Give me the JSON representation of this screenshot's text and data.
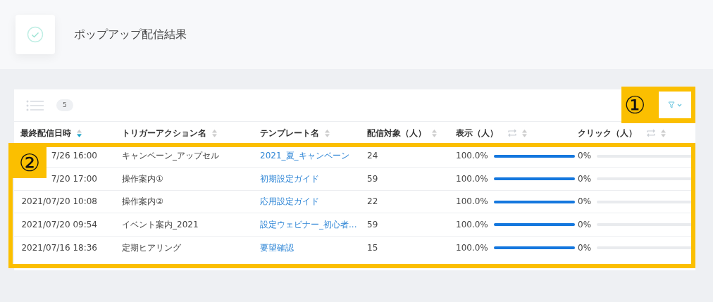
{
  "page": {
    "title": "ポップアップ配信結果"
  },
  "toolbar": {
    "count": "5"
  },
  "table": {
    "columns": [
      {
        "label": "最終配信日時",
        "sorted": true,
        "toggle": false
      },
      {
        "label": "トリガーアクション名",
        "sorted": false,
        "toggle": false
      },
      {
        "label": "テンプレート名",
        "sorted": false,
        "toggle": false
      },
      {
        "label": "配信対象（人）",
        "sorted": false,
        "toggle": false
      },
      {
        "label": "表示（人）",
        "sorted": false,
        "toggle": true
      },
      {
        "label": "クリック（人）",
        "sorted": false,
        "toggle": true
      }
    ],
    "rows": [
      {
        "date": "7/26 16:00",
        "trigger": "キャンペーン_アップセル",
        "template": "2021_夏_キャンペーン",
        "target": "24",
        "display": {
          "reading": "100.0%",
          "level": 1
        },
        "click": {
          "reading": "0%",
          "level": 0
        }
      },
      {
        "date": "7/20 17:00",
        "trigger": "操作案内①",
        "template": "初期設定ガイド",
        "target": "59",
        "display": {
          "reading": "100.0%",
          "level": 1
        },
        "click": {
          "reading": "0%",
          "level": 0
        }
      },
      {
        "date": "2021/07/20 10:08",
        "trigger": "操作案内②",
        "template": "応用設定ガイド",
        "target": "22",
        "display": {
          "reading": "100.0%",
          "level": 1
        },
        "click": {
          "reading": "0%",
          "level": 0
        }
      },
      {
        "date": "2021/07/20 09:54",
        "trigger": "イベント案内_2021",
        "template": "設定ウェビナー_初心者...",
        "target": "59",
        "display": {
          "reading": "100.0%",
          "level": 1
        },
        "click": {
          "reading": "0%",
          "level": 0
        }
      },
      {
        "date": "2021/07/16 18:36",
        "trigger": "定期ヒアリング",
        "template": "要望確認",
        "target": "15",
        "display": {
          "reading": "100.0%",
          "level": 1
        },
        "click": {
          "reading": "0%",
          "level": 0
        }
      }
    ]
  },
  "callouts": [
    {
      "label": "①"
    },
    {
      "label": "②"
    }
  ]
}
